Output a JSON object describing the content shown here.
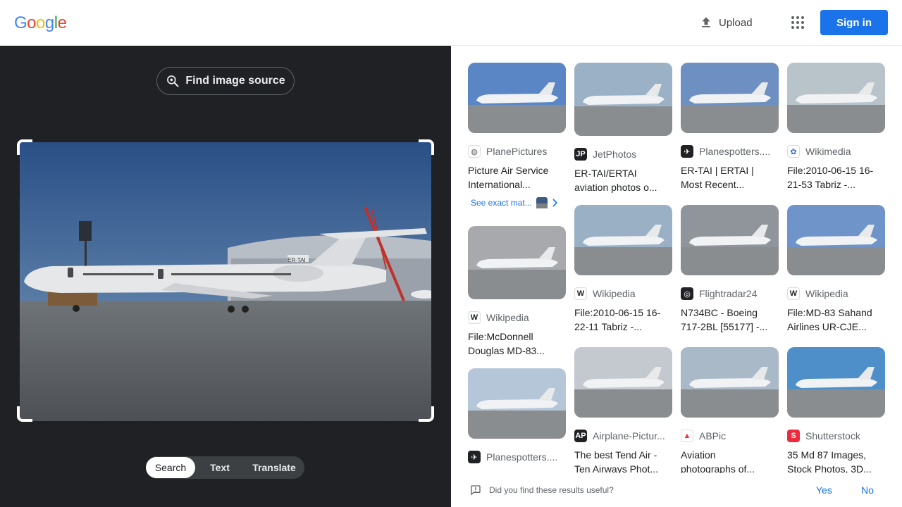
{
  "header": {
    "logo_letters": [
      {
        "ch": "G",
        "color": "#4285f4"
      },
      {
        "ch": "o",
        "color": "#ea4335"
      },
      {
        "ch": "o",
        "color": "#fbbc05"
      },
      {
        "ch": "g",
        "color": "#4285f4"
      },
      {
        "ch": "l",
        "color": "#34a853"
      },
      {
        "ch": "e",
        "color": "#ea4335"
      }
    ],
    "upload_label": "Upload",
    "signin_label": "Sign in"
  },
  "left": {
    "find_source_label": "Find image source",
    "modes": [
      "Search",
      "Text",
      "Translate"
    ],
    "active_mode": "Search"
  },
  "results": [
    {
      "source": "PlanePictures",
      "icon": "globe-icon",
      "lines": [
        "Picture Air Service",
        "International..."
      ]
    },
    {
      "source": "JetPhotos",
      "icon": "jetphotos-icon",
      "lines": [
        "ER-TAI/ERTAI",
        "aviation photos o..."
      ]
    },
    {
      "source": "Planespotters....",
      "icon": "planespotters-icon",
      "lines": [
        "ER-TAI | ERTAI |",
        "Most Recent..."
      ]
    },
    {
      "source": "Wikimedia",
      "icon": "wikimedia-icon",
      "lines": [
        "File:2010-06-15 16-",
        "21-53 Tabriz -..."
      ]
    },
    {
      "source": "Wikipedia",
      "icon": "wikipedia-icon",
      "lines": [
        "File:McDonnell",
        "Douglas MD-83..."
      ]
    },
    {
      "source": "Wikipedia",
      "icon": "wikipedia-icon",
      "lines": [
        "File:2010-06-15 16-",
        "22-11 Tabriz -..."
      ]
    },
    {
      "source": "Flightradar24",
      "icon": "flightradar-icon",
      "lines": [
        "N734BC - Boeing",
        "717-2BL [55177] -..."
      ]
    },
    {
      "source": "Wikipedia",
      "icon": "wikipedia-icon",
      "lines": [
        "File:MD-83 Sahand",
        "Airlines UR-CJE..."
      ]
    },
    {
      "source": "Planespotters....",
      "icon": "planespotters-icon",
      "lines": [
        "",
        ""
      ]
    },
    {
      "source": "Airplane-Pictur...",
      "icon": "airplane-pictures-icon",
      "lines": [
        "The best Tend Air -",
        "Ten Airways Phot..."
      ]
    },
    {
      "source": "ABPic",
      "icon": "abpic-icon",
      "lines": [
        "Aviation",
        "photographs of..."
      ]
    },
    {
      "source": "Shutterstock",
      "icon": "shutterstock-icon",
      "lines": [
        "35 Md 87 Images,",
        "Stock Photos, 3D..."
      ]
    }
  ],
  "exact_match_label": "See exact mat...",
  "feedback": {
    "question": "Did you find these results useful?",
    "yes": "Yes",
    "no": "No"
  },
  "colors": {
    "accent": "#1a73e8",
    "dark_panel": "#202124"
  }
}
